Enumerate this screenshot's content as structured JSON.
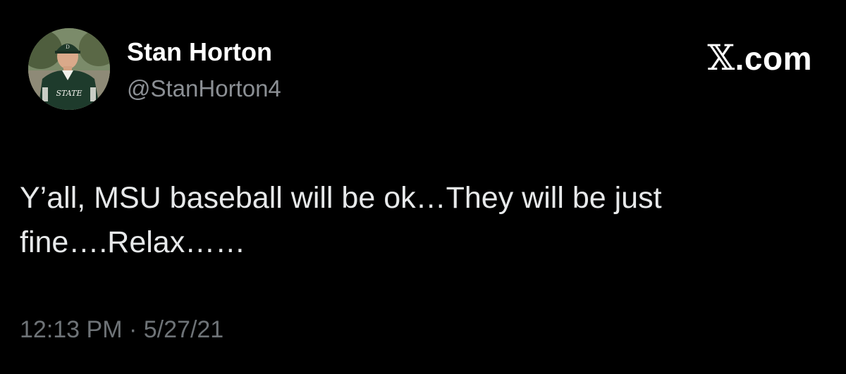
{
  "author": {
    "name": "Stan Horton",
    "handle": "@StanHorton4",
    "avatar_jersey_text": "STATE"
  },
  "brand": {
    "label": ".com",
    "icon": "x-logo-icon"
  },
  "tweet": {
    "text": "Y’all, MSU baseball will be ok…They will be just\nfine….Relax……",
    "time": "12:13 PM",
    "separator": "·",
    "date": "5/27/21"
  },
  "colors": {
    "background": "#000000",
    "primary_text": "#e7e9ea",
    "secondary_text": "#8b8f94"
  }
}
